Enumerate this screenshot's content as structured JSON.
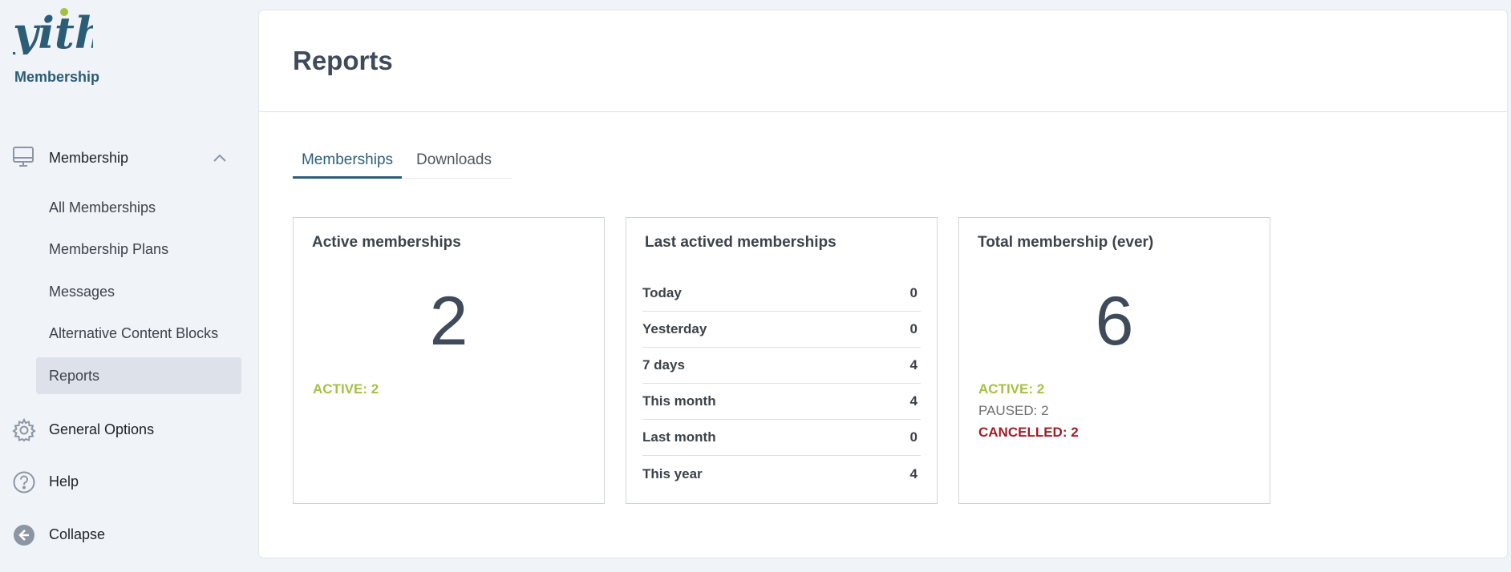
{
  "sidebar": {
    "brand": "Membership",
    "parent": {
      "label": "Membership",
      "icon": "monitor-icon"
    },
    "sub_items": [
      {
        "label": "All Memberships"
      },
      {
        "label": "Membership Plans"
      },
      {
        "label": "Messages"
      },
      {
        "label": "Alternative Content Blocks"
      },
      {
        "label": "Reports"
      }
    ],
    "general_options": "General Options",
    "help": "Help",
    "collapse": "Collapse"
  },
  "page": {
    "title": "Reports",
    "tabs": [
      {
        "label": "Memberships"
      },
      {
        "label": "Downloads"
      }
    ]
  },
  "cards": {
    "active": {
      "title": "Active memberships",
      "number": "2",
      "stat_active": "ACTIVE: 2"
    },
    "last": {
      "title": "Last actived memberships",
      "rows": [
        {
          "label": "Today",
          "value": "0"
        },
        {
          "label": "Yesterday",
          "value": "0"
        },
        {
          "label": "7 days",
          "value": "4"
        },
        {
          "label": "This month",
          "value": "4"
        },
        {
          "label": "Last month",
          "value": "0"
        },
        {
          "label": "This year",
          "value": "4"
        }
      ]
    },
    "total": {
      "title": "Total membership (ever)",
      "number": "6",
      "stat_active": "ACTIVE: 2",
      "stat_paused": "PAUSED: 2",
      "stat_cancelled": "CANCELLED: 2"
    }
  },
  "colors": {
    "accent": "#2d5e7a",
    "active": "#a5c045",
    "cancelled": "#a11d2a",
    "logo_dot": "#a5c045"
  }
}
